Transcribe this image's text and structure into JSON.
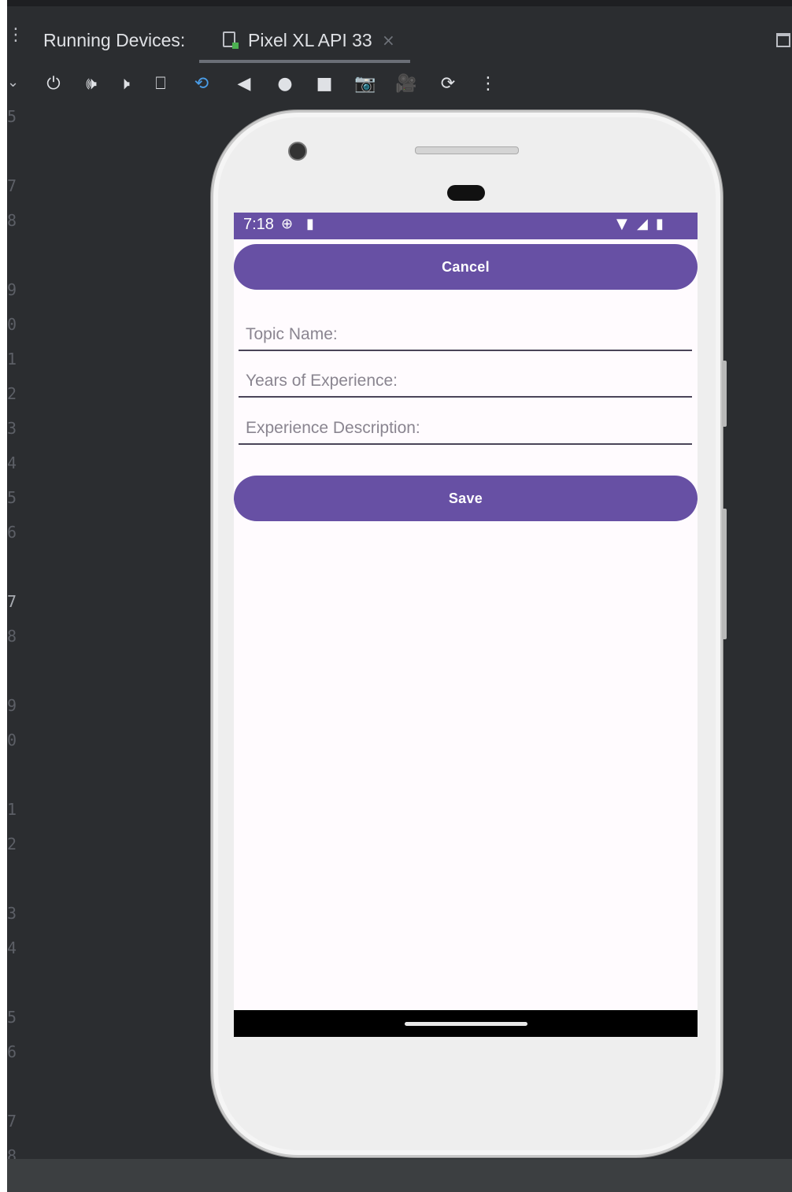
{
  "ide": {
    "panel_title": "Running Devices:",
    "device_tab": "Pixel XL API 33",
    "close_glyph": "×",
    "toolbar_icons": [
      "power-icon",
      "volume-up-icon",
      "volume-down-icon",
      "rotate-left-icon",
      "rotate-right-icon",
      "back-icon",
      "home-icon",
      "overview-icon",
      "camera-icon",
      "video-icon",
      "snapshot-icon",
      "more-icon"
    ],
    "line_numbers": [
      "5",
      "7",
      "8",
      "9",
      "0",
      "1",
      "2",
      "3",
      "4",
      "5",
      "6",
      "7",
      "8",
      "9",
      "0",
      "1",
      "2",
      "3",
      "4",
      "5",
      "6",
      "7",
      "8"
    ],
    "accent_color": "#4a9de8"
  },
  "device": {
    "status_bar": {
      "time": "7:18",
      "color": "#6750a4"
    },
    "cancel_button": "Cancel",
    "fields": {
      "topic_name": "Topic Name:",
      "years_experience": "Years of Experience:",
      "experience_description": "Experience Description:"
    },
    "save_button": "Save"
  }
}
